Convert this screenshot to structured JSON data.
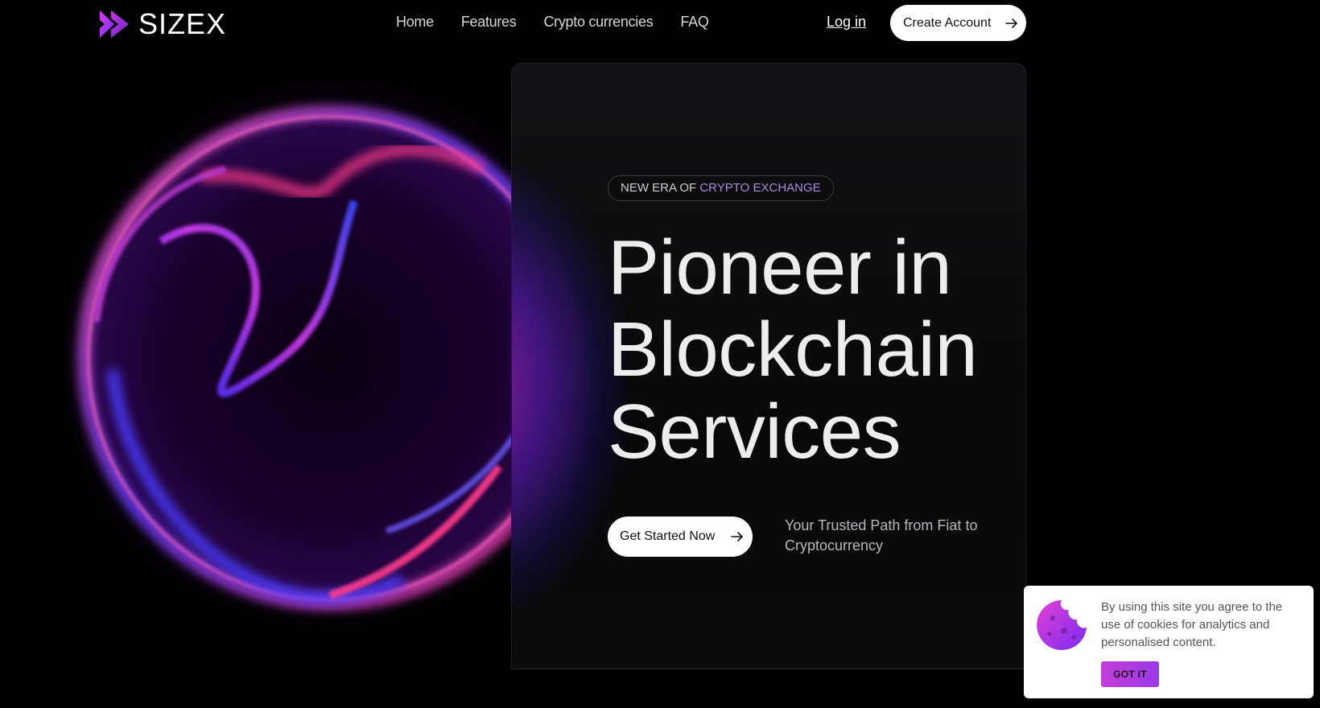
{
  "brand": {
    "name": "SIZEX"
  },
  "nav": {
    "items": [
      {
        "label": "Home"
      },
      {
        "label": "Features"
      },
      {
        "label": "Crypto currencies"
      },
      {
        "label": "FAQ"
      }
    ]
  },
  "header": {
    "login_label": "Log in",
    "create_account_label": "Create Account"
  },
  "hero": {
    "badge_part1": "NEW ERA OF ",
    "badge_part2": "CRYPTO EXCHANGE",
    "headline_lines": [
      "Pioneer in",
      "Blockchain",
      "Services"
    ],
    "cta_label": "Get Started Now",
    "tagline": "Your Trusted Path from Fiat to Cryptocurrency"
  },
  "cookie": {
    "text": "By using this site you agree to the use of cookies for analytics and personalised content.",
    "button_label": "GOT IT"
  },
  "colors": {
    "background": "#000000",
    "accent_purple": "#9b38e6",
    "accent_magenta": "#c23ed8",
    "orb_pink": "#ff3a8c",
    "orb_blue": "#3a3aff"
  },
  "icons": {
    "logo": "sizex-logo-icon",
    "arrow": "arrow-right-icon",
    "cookie": "cookie-icon"
  }
}
